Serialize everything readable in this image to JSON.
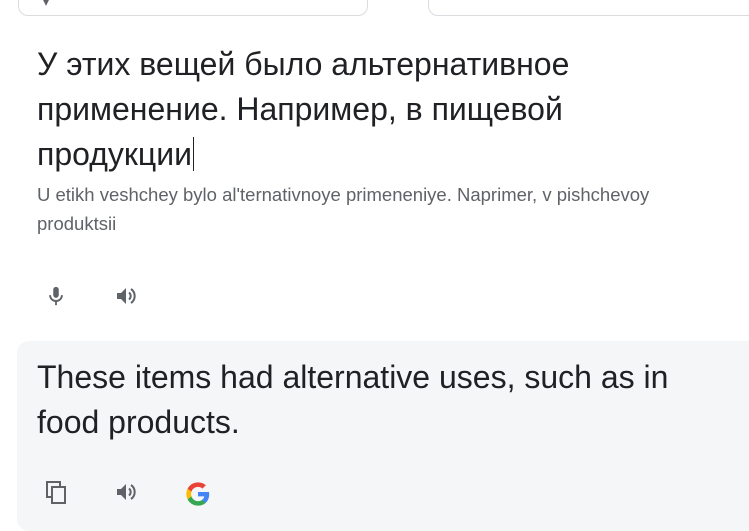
{
  "source": {
    "text": "У этих вещей было альтернативное применение. Например, в пищевой продукции",
    "transliteration": "U etikh veshchey bylo al'ternativnoye primeneniye. Naprimer, v pishchevoy produktsii"
  },
  "source_actions": [
    {
      "icon": "microphone-icon"
    },
    {
      "icon": "speaker-icon"
    }
  ],
  "target": {
    "text": "These items had alternative uses, such as in food products."
  },
  "target_actions": [
    {
      "icon": "copy-icon"
    },
    {
      "icon": "speaker-icon"
    },
    {
      "icon": "google-g-icon"
    }
  ],
  "colors": {
    "text_primary": "#202124",
    "text_secondary": "#5f6368",
    "target_panel_bg": "#f5f6f7",
    "google_blue": "#4285f4",
    "google_red": "#ea4335",
    "google_yellow": "#fbbc05",
    "google_green": "#34a853"
  }
}
